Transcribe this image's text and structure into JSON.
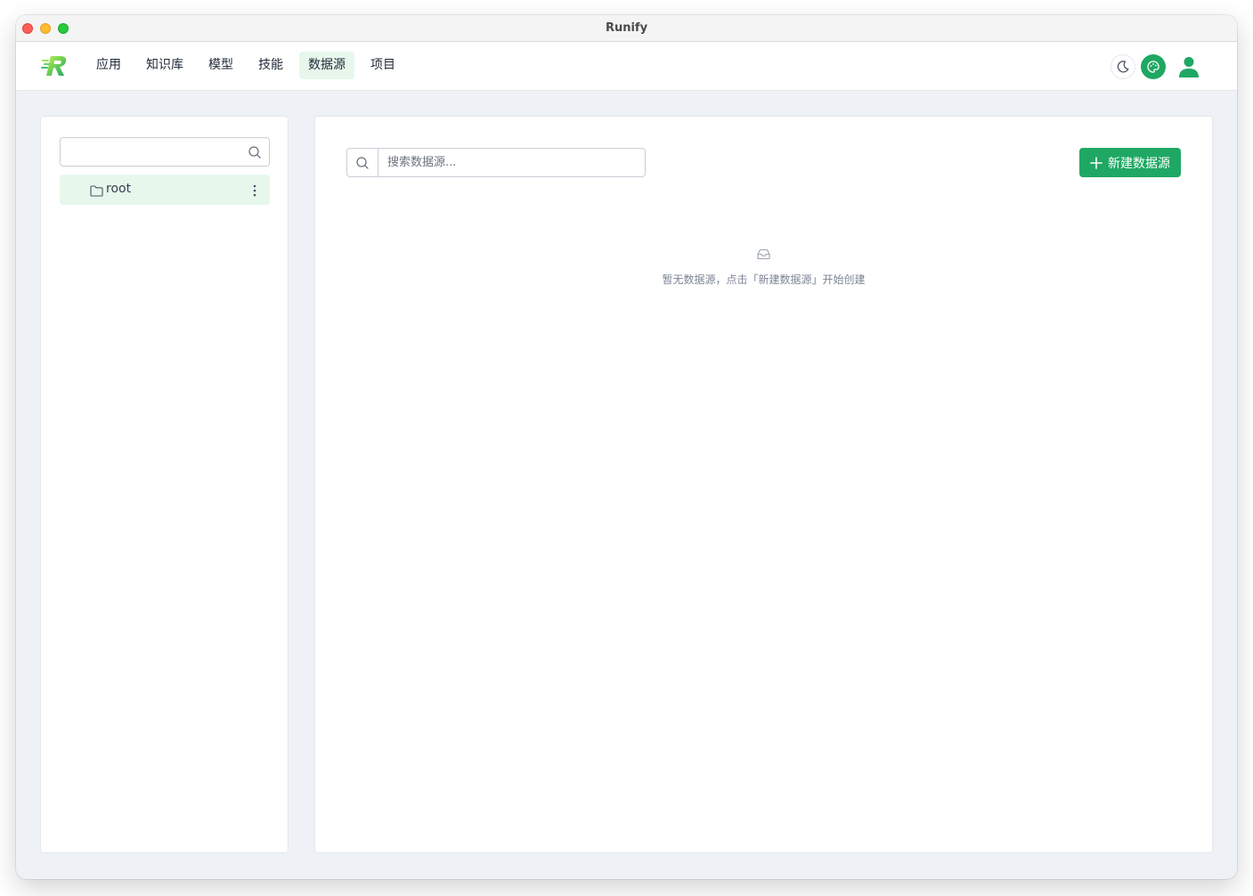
{
  "window": {
    "title": "Runify"
  },
  "nav": {
    "items": [
      {
        "label": "应用",
        "active": false
      },
      {
        "label": "知识库",
        "active": false
      },
      {
        "label": "模型",
        "active": false
      },
      {
        "label": "技能",
        "active": false
      },
      {
        "label": "数据源",
        "active": true
      },
      {
        "label": "项目",
        "active": false
      }
    ],
    "right_icons": [
      "moon-icon",
      "palette-icon",
      "user-icon"
    ]
  },
  "tree": {
    "search_placeholder": "",
    "items": [
      {
        "label": "root",
        "icon": "folder-icon"
      }
    ]
  },
  "main": {
    "search_placeholder": "搜索数据源...",
    "new_button_label": "新建数据源",
    "empty_text": "暂无数据源，点击「新建数据源」开始创建"
  },
  "colors": {
    "accent": "#1fa863",
    "active_bg": "#e7f7ec",
    "page_bg": "#eef2f6"
  }
}
